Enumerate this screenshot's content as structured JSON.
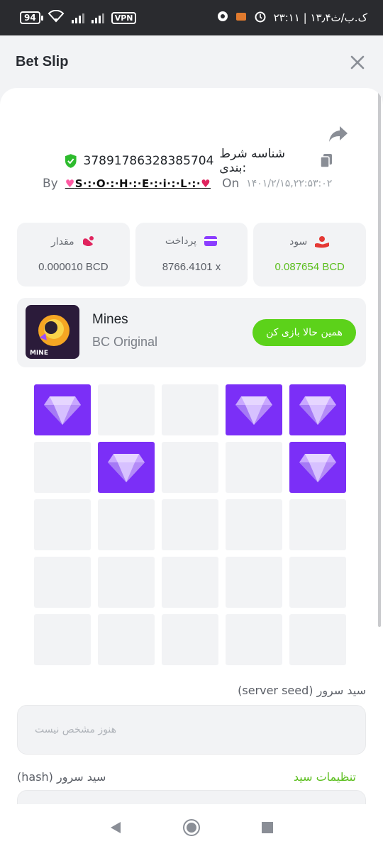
{
  "status_bar": {
    "time": "۲۳:۱۱ | ۱۳٫۴ک.ب/ث",
    "battery": "94",
    "vpn": "VPN"
  },
  "header": {
    "title": "Bet Slip"
  },
  "bet": {
    "id_label": "شناسه شرط بندی:",
    "id_value": "37891786328385704",
    "by_label": "By",
    "username": "S·:·O·:·H·:·E·:·i·:·L·:·",
    "on_label": "On",
    "timestamp": "۱۴۰۱/۲/۱۵,۲۲:۵۳:۰۲"
  },
  "stats": [
    {
      "label": "مقدار",
      "value": "0.000010 BCD",
      "icon": "amount-icon",
      "color": "#e0245e"
    },
    {
      "label": "پرداخت",
      "value": "8766.4101 x",
      "icon": "card-icon",
      "color": "#8b3dff"
    },
    {
      "label": "سود",
      "value": "0.087654 BCD",
      "icon": "profit-icon",
      "color": "#e53935"
    }
  ],
  "game": {
    "name": "Mines",
    "provider": "BC Original",
    "thumb_label": "MINE",
    "play_label": "همین حالا بازی کن"
  },
  "grid": {
    "rows": 5,
    "cols": 5,
    "gems": [
      0,
      3,
      4,
      6,
      9
    ]
  },
  "seeds": {
    "server_label": "(server seed) سید سرور",
    "server_placeholder": "هنوز مشخص نیست",
    "hash_label": "(hash) سید سرور",
    "settings_link": "تنظیمات سید"
  },
  "colors": {
    "accent_green": "#5cd21a",
    "gem_purple": "#7b2ff7"
  }
}
